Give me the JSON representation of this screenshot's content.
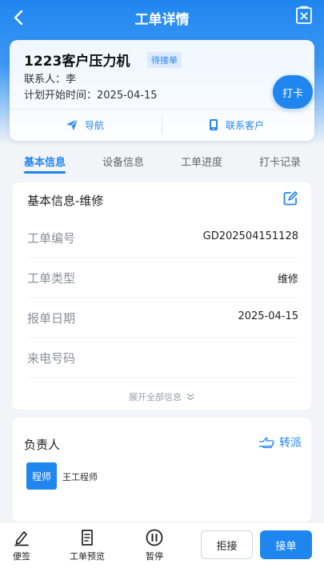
{
  "header": {
    "title": "工单详情"
  },
  "order": {
    "title": "1223客户压力机",
    "status": "待接单",
    "contact": "联系人：李",
    "start_time": "计划开始时间：2025-04-15",
    "checkin_label": "打卡",
    "navigate_label": "导航",
    "contact_customer_label": "联系客户"
  },
  "tabs": [
    {
      "label": "基本信息"
    },
    {
      "label": "设备信息"
    },
    {
      "label": "工单进度"
    },
    {
      "label": "打卡记录"
    }
  ],
  "basic_info": {
    "title": "基本信息-维修",
    "rows": [
      {
        "label": "工单编号",
        "value": "GD202504151128"
      },
      {
        "label": "工单类型",
        "value": "维修"
      },
      {
        "label": "报单日期",
        "value": "2025-04-15"
      },
      {
        "label": "来电号码",
        "value": ""
      }
    ],
    "expand_label": "展开全部信息"
  },
  "owner": {
    "title": "负责人",
    "reassign_label": "转派",
    "role_tag": "程师",
    "engineer_name": "王工程师"
  },
  "bottom_bar": {
    "note_label": "便签",
    "preview_label": "工单预览",
    "pause_label": "暂停",
    "reject_label": "拒接",
    "accept_label": "接单"
  },
  "colors": {
    "accent": "#1f86f0",
    "badge_bg": "#dcebfb"
  }
}
